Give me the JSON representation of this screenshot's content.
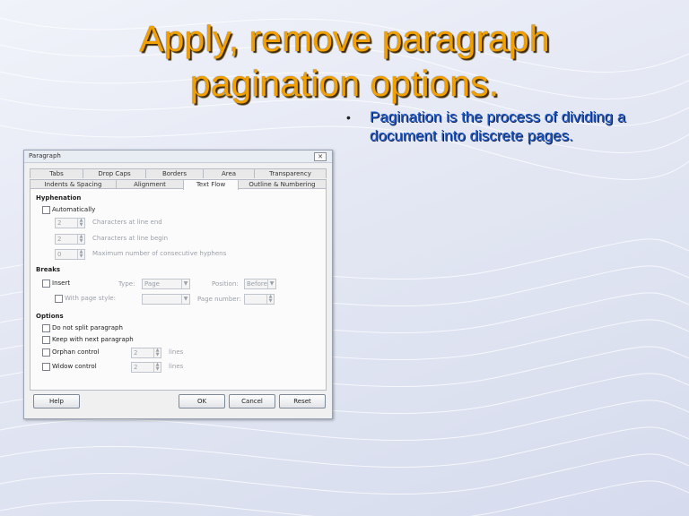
{
  "slide": {
    "title_line1": "Apply, remove paragraph",
    "title_line2": "pagination options.",
    "bullet": "•",
    "bullet_text": "Pagination is the process of dividing a document into discrete pages.",
    "colors": {
      "title": "#f2a000",
      "bullet_text": "#1a56c8",
      "background": "#e3e7f3"
    }
  },
  "dialog": {
    "title": "Paragraph",
    "close_glyph": "✕",
    "tabs_row1": [
      "Tabs",
      "Drop Caps",
      "Borders",
      "Area",
      "Transparency"
    ],
    "tabs_row2": [
      "Indents & Spacing",
      "Alignment",
      "Text Flow",
      "Outline & Numbering"
    ],
    "active_tab": "Text Flow",
    "hyphenation": {
      "heading": "Hyphenation",
      "automatically": "Automatically",
      "fields": [
        {
          "value": "2",
          "label": "Characters at line end"
        },
        {
          "value": "2",
          "label": "Characters at line begin"
        },
        {
          "value": "0",
          "label": "Maximum number of consecutive hyphens"
        }
      ]
    },
    "breaks": {
      "heading": "Breaks",
      "insert": "Insert",
      "type_label": "Type:",
      "type_value": "Page",
      "position_label": "Position:",
      "position_value": "Before",
      "with_page_style": "With page style:",
      "page_style_value": "",
      "page_number_label": "Page number:",
      "page_number_value": ""
    },
    "options": {
      "heading": "Options",
      "do_not_split": "Do not split paragraph",
      "keep_with_next": "Keep with next paragraph",
      "orphan": {
        "label": "Orphan control",
        "value": "2",
        "unit": "lines"
      },
      "widow": {
        "label": "Widow control",
        "value": "2",
        "unit": "lines"
      }
    },
    "buttons": {
      "help": "Help",
      "ok": "OK",
      "cancel": "Cancel",
      "reset": "Reset"
    }
  }
}
